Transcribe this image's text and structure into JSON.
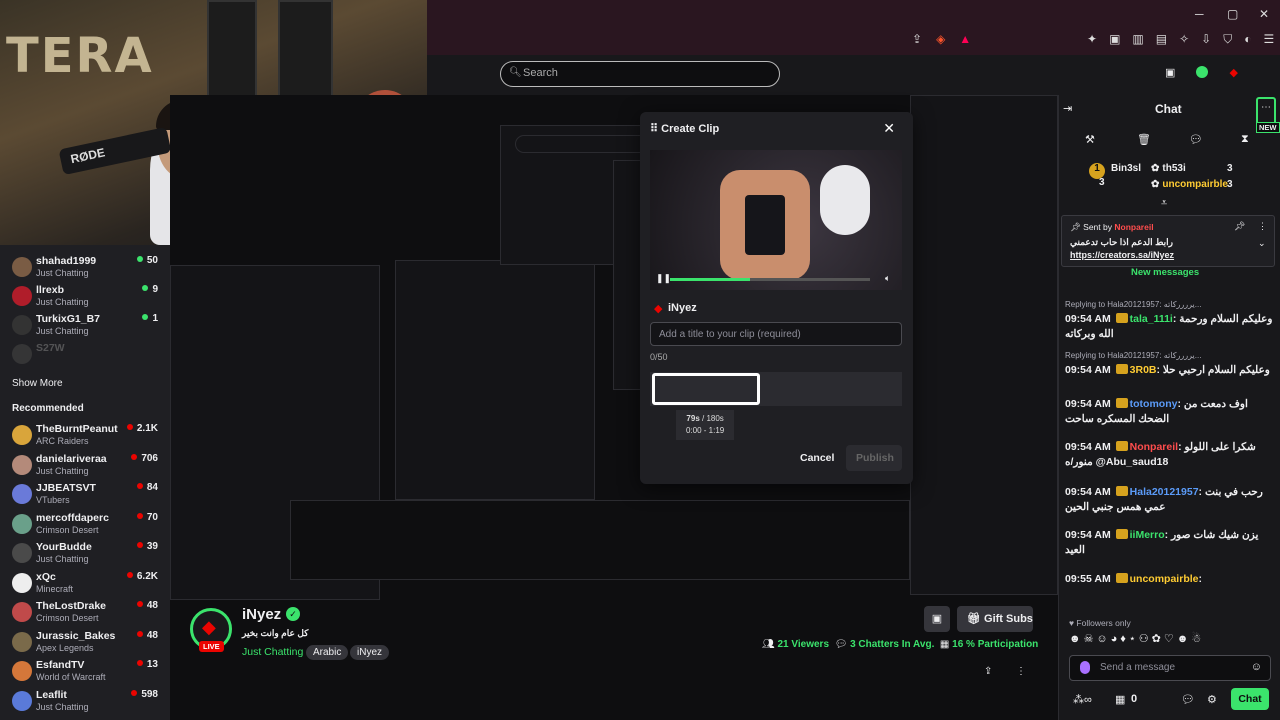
{
  "window": {
    "minimize": "─",
    "maximize": "▢",
    "close": "✕"
  },
  "search": {
    "placeholder": "Search"
  },
  "webcam": {
    "sign": "TERA",
    "mic_brand": "RØDE"
  },
  "sidebar": {
    "top_channels": [
      {
        "name": "shahad1999",
        "category": "Just Chatting",
        "viewers": "50",
        "color": "#7a5c44",
        "live": "green"
      },
      {
        "name": "llrexb",
        "category": "Just Chatting",
        "viewers": "9",
        "color": "#b01d2a",
        "live": "green"
      },
      {
        "name": "TurkixG1_B7",
        "category": "Just Chatting",
        "viewers": "1",
        "color": "#333",
        "live": "green"
      }
    ],
    "offline": {
      "name": "S27W",
      "icon": "offline-icon"
    },
    "show_more": "Show More",
    "recommended_label": "Recommended",
    "recommended": [
      {
        "name": "TheBurntPeanut",
        "category": "ARC Raiders",
        "viewers": "2.1K",
        "color": "#d9a53b"
      },
      {
        "name": "danielariveraa",
        "category": "Just Chatting",
        "viewers": "706",
        "color": "#b48a7a"
      },
      {
        "name": "JJBEATSVT",
        "category": "VTubers",
        "viewers": "84",
        "color": "#6a7ad9"
      },
      {
        "name": "mercoffdaperc",
        "category": "Crimson Desert",
        "viewers": "70",
        "color": "#6aa08a"
      },
      {
        "name": "YourBudde",
        "category": "Just Chatting",
        "viewers": "39",
        "color": "#4a4a4a"
      },
      {
        "name": "xQc",
        "category": "Minecraft",
        "viewers": "6.2K",
        "color": "#eee"
      },
      {
        "name": "TheLostDrake",
        "category": "Crimson Desert",
        "viewers": "48",
        "color": "#c04a4a"
      },
      {
        "name": "Jurassic_Bakes",
        "category": "Apex Legends",
        "viewers": "48",
        "color": "#7a6a4a"
      },
      {
        "name": "EsfandTV",
        "category": "World of Warcraft",
        "viewers": "13",
        "color": "#d4773a"
      },
      {
        "name": "Leaflit",
        "category": "Just Chatting",
        "viewers": "598",
        "color": "#5a7ad9"
      }
    ]
  },
  "clip_dialog": {
    "title": "Create Clip",
    "channel": "iNyez",
    "title_placeholder": "Add a title to your clip (required)",
    "char_count": "0/50",
    "duration": "79s",
    "duration_max": "/ 180s",
    "range": "0:00 - 1:19",
    "cancel": "Cancel",
    "publish": "Publish",
    "progress": 0.4
  },
  "channel": {
    "name": "iNyez",
    "live": "LIVE",
    "title": "كل عام وانت بخير",
    "category": "Just Chatting",
    "tags": [
      "Arabic",
      "iNyez"
    ],
    "gift_subs": "Gift Subs",
    "viewers": "21",
    "viewers_label": "Viewers",
    "chatters": "3",
    "chatters_label": "Chatters In Avg.",
    "participation": "16",
    "participation_label": "% Participation"
  },
  "chat": {
    "title": "Chat",
    "new_label": "NEW",
    "leaderboard": [
      {
        "rank": "1",
        "name": "Bin3sl",
        "count": "3"
      },
      {
        "rank": "",
        "name": "th53i",
        "count": "3"
      },
      {
        "rank": "",
        "name": "uncompairble",
        "count": "3"
      }
    ],
    "pinned": {
      "sent_by": "Sent by",
      "sender": "Nonpareil",
      "message": "رابط الدعم اذا حاب تدعمني",
      "link": "https://creators.sa/iNyez"
    },
    "new_messages": "New messages",
    "messages": [
      {
        "reply": "Replying to Hala20121957: يرررركاته...",
        "time": "09:54 AM",
        "user": "tala_111i",
        "user_color": "#3be36c",
        "text": "وعليكم السلام ورحمة الله وبركاته"
      },
      {
        "reply": "Replying to Hala20121957: يرررركاته...",
        "time": "09:54 AM",
        "user": "3R0B",
        "user_color": "#ffcc33",
        "text": "وعليكم السلام ارحبي حلا"
      },
      {
        "reply": "",
        "time": "09:54 AM",
        "user": "totomony",
        "user_color": "#5b9bf8",
        "text": "اوف دمعت من الضحك المسكره ساحت"
      },
      {
        "reply": "",
        "time": "09:54 AM",
        "user": "Nonpareil",
        "user_color": "#ff4d4d",
        "text": "شكرا على اللولو منور/ه @Abu_saud18"
      },
      {
        "reply": "",
        "time": "09:54 AM",
        "user": "Hala20121957",
        "user_color": "#5b9bf8",
        "text": "رحب في بنت عمي همس جنبي الحين"
      },
      {
        "reply": "",
        "time": "09:54 AM",
        "user": "iiMerro",
        "user_color": "#3be36c",
        "text": "يزن شيك شات صور العيد"
      },
      {
        "reply": "",
        "time": "09:55 AM",
        "user": "uncompairble",
        "user_color": "#ffcc33",
        "text": ""
      }
    ],
    "followers_only": "Followers only",
    "send_placeholder": "Send a message",
    "points": "0",
    "chat_button": "Chat"
  }
}
